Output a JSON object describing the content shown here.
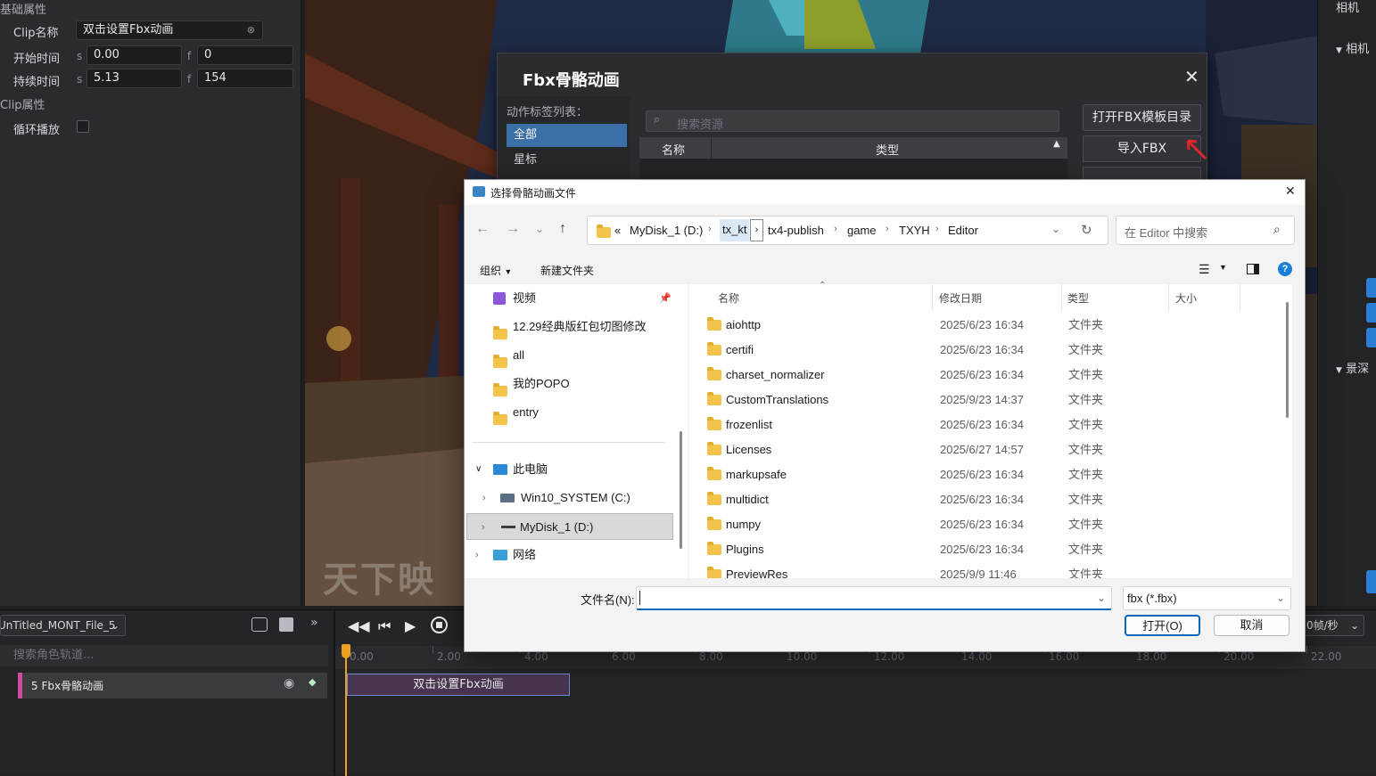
{
  "left_panel": {
    "basic_props": "基础属性",
    "clip_name_label": "Clip名称",
    "clip_name_value": "双击设置Fbx动画",
    "start_label": "开始时间",
    "start_s_unit": "s",
    "start_s": "0.00",
    "start_f_unit": "f",
    "start_f": "0",
    "dur_label": "持续时间",
    "dur_s_unit": "s",
    "dur_s": "5.13",
    "dur_f_unit": "f",
    "dur_f": "154",
    "clip_props": "Clip属性",
    "loop_label": "循环播放"
  },
  "right_panel": {
    "title": "相机",
    "camera_section": "相机",
    "dof_section": "景深"
  },
  "viewport": {
    "watermark": "天下映"
  },
  "fbx_dialog": {
    "title": "Fbx骨骼动画",
    "tag_list_label": "动作标签列表：",
    "tags": [
      "全部",
      "星标"
    ],
    "search_placeholder": "搜索资源",
    "col_name": "名称",
    "col_type": "类型",
    "btn_open_template": "打开FBX模板目录",
    "btn_import": "导入FBX"
  },
  "file_dialog": {
    "title": "选择骨骼动画文件",
    "breadcrumb": [
      "«",
      "MyDisk_1 (D:)",
      "tx_kt",
      "tx4-publish",
      "game",
      "TXYH",
      "Editor"
    ],
    "search_placeholder": "在 Editor 中搜索",
    "organize": "组织",
    "new_folder": "新建文件夹",
    "nav": {
      "quick": [
        {
          "label": "视频"
        },
        {
          "label": "12.29经典版红包切图修改"
        },
        {
          "label": "all"
        },
        {
          "label": "我的POPO"
        },
        {
          "label": "entry"
        }
      ],
      "this_pc": "此电脑",
      "drives": [
        "Win10_SYSTEM (C:)",
        "MyDisk_1 (D:)"
      ],
      "network": "网络"
    },
    "columns": {
      "name": "名称",
      "date": "修改日期",
      "type": "类型",
      "size": "大小"
    },
    "files": [
      {
        "name": "aiohttp",
        "date": "2025/6/23 16:34",
        "type": "文件夹"
      },
      {
        "name": "certifi",
        "date": "2025/6/23 16:34",
        "type": "文件夹"
      },
      {
        "name": "charset_normalizer",
        "date": "2025/6/23 16:34",
        "type": "文件夹"
      },
      {
        "name": "CustomTranslations",
        "date": "2025/9/23 14:37",
        "type": "文件夹"
      },
      {
        "name": "frozenlist",
        "date": "2025/6/23 16:34",
        "type": "文件夹"
      },
      {
        "name": "Licenses",
        "date": "2025/6/27 14:57",
        "type": "文件夹"
      },
      {
        "name": "markupsafe",
        "date": "2025/6/23 16:34",
        "type": "文件夹"
      },
      {
        "name": "multidict",
        "date": "2025/6/23 16:34",
        "type": "文件夹"
      },
      {
        "name": "numpy",
        "date": "2025/6/23 16:34",
        "type": "文件夹"
      },
      {
        "name": "Plugins",
        "date": "2025/6/23 16:34",
        "type": "文件夹"
      },
      {
        "name": "PreviewRes",
        "date": "2025/9/9 11:46",
        "type": "文件夹"
      }
    ],
    "filename_label": "文件名(N):",
    "filename_value": "",
    "filter": "fbx (*.fbx)",
    "open_btn": "打开(O)",
    "cancel_btn": "取消"
  },
  "timeline": {
    "file_select": "UnTitled_MONT_File_5",
    "search_placeholder": "搜索角色轨道...",
    "track_name": "5 Fbx骨骼动画",
    "clip_label": "双击设置Fbx动画",
    "fps_label": "0帧/秒",
    "ticks": [
      "0.00",
      "2.00",
      "4.00",
      "6.00",
      "8.00",
      "10.00",
      "12.00",
      "14.00",
      "16.00",
      "18.00",
      "20.00",
      "22.00"
    ]
  },
  "colors": {
    "accent_blue": "#3a6fa8",
    "playhead": "#f0a020",
    "track_pink": "#d24a9c",
    "red_arrow": "#e0252b",
    "win_blue": "#0067c0"
  }
}
